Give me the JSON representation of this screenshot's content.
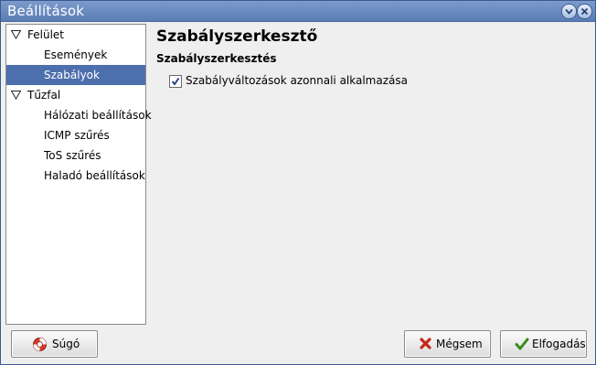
{
  "window": {
    "title": "Beállítások"
  },
  "titlebar_buttons": {
    "menu_icon": "chevron-down-icon",
    "close_icon": "close-icon"
  },
  "sidebar": {
    "items": [
      {
        "label": "Felület",
        "level": 0,
        "expanded": true,
        "selected": false
      },
      {
        "label": "Események",
        "level": 1,
        "selected": false
      },
      {
        "label": "Szabályok",
        "level": 1,
        "selected": true
      },
      {
        "label": "Tűzfal",
        "level": 0,
        "expanded": true,
        "selected": false
      },
      {
        "label": "Hálózati beállítások",
        "level": 1,
        "selected": false
      },
      {
        "label": "ICMP szűrés",
        "level": 1,
        "selected": false
      },
      {
        "label": "ToS szűrés",
        "level": 1,
        "selected": false
      },
      {
        "label": "Haladó beállítások",
        "level": 1,
        "selected": false
      }
    ]
  },
  "main": {
    "heading": "Szabályszerkesztő",
    "section_title": "Szabályszerkesztés",
    "option": {
      "label": "Szabályváltozások azonnali alkalmazása",
      "checked": true
    }
  },
  "buttons": {
    "help": "Súgó",
    "cancel": "Mégsem",
    "accept": "Elfogadás"
  },
  "colors": {
    "titlebar": "#6688c0",
    "selection": "#4e6fad",
    "background": "#efefef"
  }
}
